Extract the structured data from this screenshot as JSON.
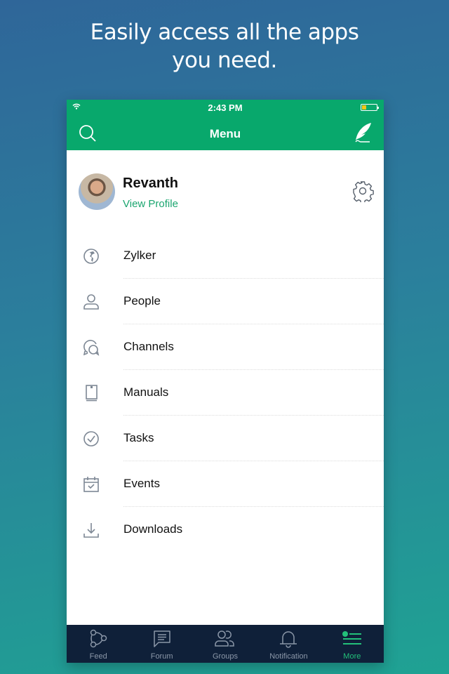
{
  "headline": {
    "line1": "Easily access all the apps",
    "line2": "you need."
  },
  "status_bar": {
    "time": "2:43 PM",
    "wifi_icon": "wifi-icon",
    "battery_icon": "battery-low-icon",
    "battery_level_percent": 20
  },
  "nav_bar": {
    "title": "Menu",
    "left_icon": "search-icon",
    "right_icon": "quill-compose-icon"
  },
  "profile": {
    "name": "Revanth",
    "link": "View Profile",
    "settings_icon": "gear-icon"
  },
  "menu": {
    "items": [
      {
        "label": "Zylker",
        "icon": "globe-icon"
      },
      {
        "label": "People",
        "icon": "person-icon"
      },
      {
        "label": "Channels",
        "icon": "chat-bubbles-icon"
      },
      {
        "label": "Manuals",
        "icon": "book-icon"
      },
      {
        "label": "Tasks",
        "icon": "check-circle-icon"
      },
      {
        "label": "Events",
        "icon": "calendar-check-icon"
      },
      {
        "label": "Downloads",
        "icon": "download-icon"
      }
    ]
  },
  "tab_bar": {
    "active": "More",
    "tabs": [
      {
        "label": "Feed",
        "icon": "feed-nodes-icon"
      },
      {
        "label": "Forum",
        "icon": "forum-icon"
      },
      {
        "label": "Groups",
        "icon": "groups-icon"
      },
      {
        "label": "Notification",
        "icon": "bell-icon"
      },
      {
        "label": "More",
        "icon": "more-list-icon"
      }
    ]
  },
  "colors": {
    "brand_green": "#08a86c",
    "link_green": "#1aa56f",
    "tab_bg": "#0f2039",
    "tab_active": "#23c07a",
    "icon_gray": "#7d8794"
  }
}
